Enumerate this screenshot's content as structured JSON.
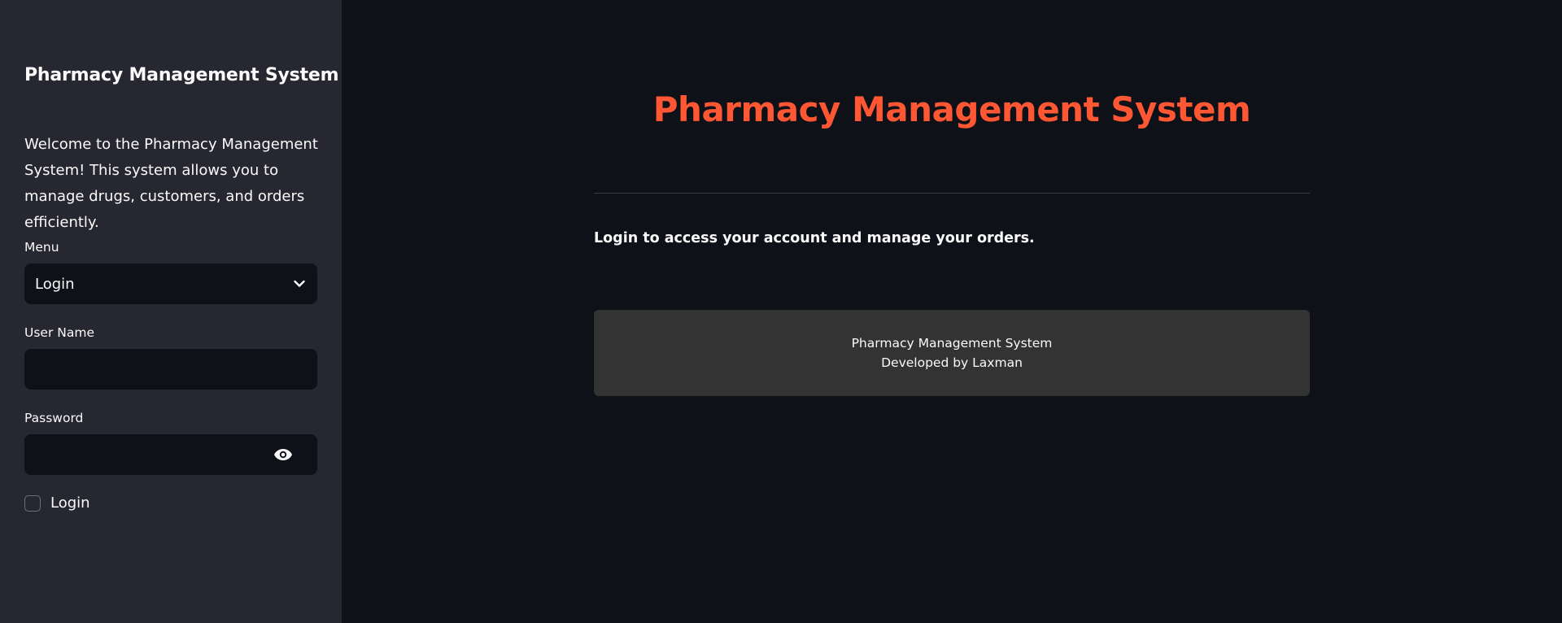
{
  "sidebar": {
    "title": "Pharmacy Management System",
    "welcome": "Welcome to the Pharmacy Management System! This system allows you to manage drugs, customers, and orders efficiently.",
    "menu_label": "Menu",
    "menu_selected": "Login",
    "username_label": "User Name",
    "username_value": "",
    "password_label": "Password",
    "password_value": "",
    "login_checkbox_label": "Login",
    "login_checkbox_checked": false
  },
  "main": {
    "title": "Pharmacy Management System",
    "login_message": "Login to access your account and manage your orders.",
    "footer": {
      "line1": "Pharmacy Management System",
      "line2": "Developed by Laxman"
    }
  },
  "colors": {
    "accent_title": "#ff5733",
    "sidebar_bg": "#262730",
    "main_bg": "#0e1117",
    "footer_bg": "#333333"
  },
  "icons": {
    "select": "chevron-down-icon",
    "password_toggle": "eye-icon"
  }
}
